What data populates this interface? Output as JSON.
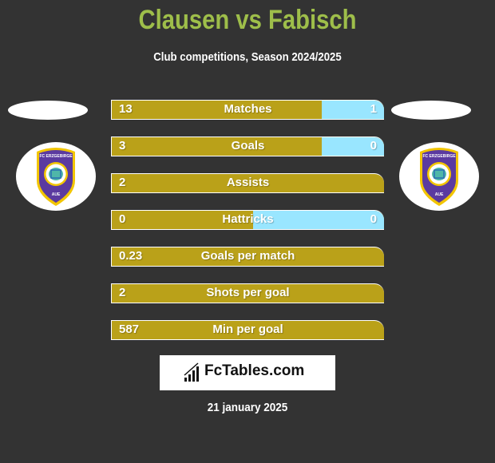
{
  "header": {
    "title": "Clausen vs Fabisch",
    "subtitle": "Club competitions, Season 2024/2025"
  },
  "players": {
    "left": {
      "club_crest": "fc-erzgebirge-aue-crest",
      "crest_text_top": "FC ERZGEBIRGE",
      "crest_text_bottom": "AUE"
    },
    "right": {
      "club_crest": "fc-erzgebirge-aue-crest",
      "crest_text_top": "FC ERZGEBIRGE",
      "crest_text_bottom": "AUE"
    }
  },
  "colors": {
    "left_bar": "#baa119",
    "right_bar": "#99e6ff",
    "title": "#9ebe4a",
    "background": "#333333"
  },
  "stats": [
    {
      "label": "Matches",
      "left": "13",
      "right": "1",
      "right_share": 0.23
    },
    {
      "label": "Goals",
      "left": "3",
      "right": "0",
      "right_share": 0.23
    },
    {
      "label": "Assists",
      "left": "2",
      "right": "",
      "right_share": 0
    },
    {
      "label": "Hattricks",
      "left": "0",
      "right": "0",
      "right_share": 0.48
    },
    {
      "label": "Goals per match",
      "left": "0.23",
      "right": "",
      "right_share": 0
    },
    {
      "label": "Shots per goal",
      "left": "2",
      "right": "",
      "right_share": 0
    },
    {
      "label": "Min per goal",
      "left": "587",
      "right": "",
      "right_share": 0
    }
  ],
  "footer": {
    "logo_text": "FcTables.com",
    "logo_icon": "bar-chart-icon",
    "date": "21 january 2025"
  }
}
